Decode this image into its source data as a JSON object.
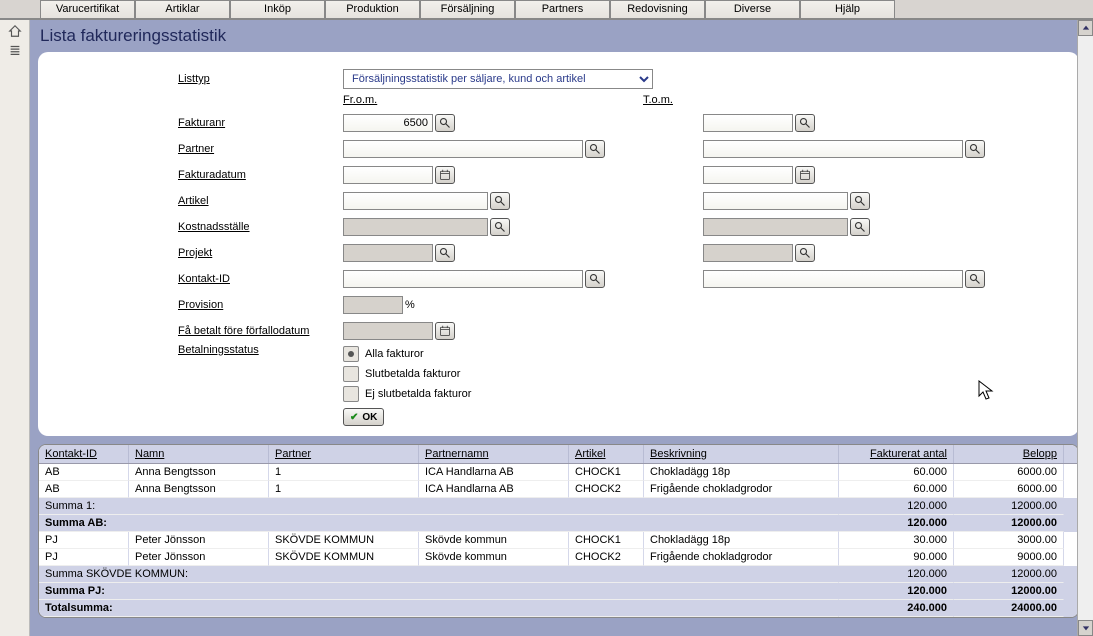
{
  "tabs": [
    "Varucertifikat",
    "Artiklar",
    "Inköp",
    "Produktion",
    "Försäljning",
    "Partners",
    "Redovisning",
    "Diverse",
    "Hjälp"
  ],
  "page_title": "Lista faktureringsstatistik",
  "labels": {
    "listtyp": "Listtyp",
    "from": "Fr.o.m.",
    "tom": "T.o.m.",
    "fakturanr": "Fakturanr",
    "partner": "Partner",
    "fakturadatum": "Fakturadatum",
    "artikel": "Artikel",
    "kostnadsstalle": "Kostnadsställe",
    "projekt": "Projekt",
    "kontaktid": "Kontakt-ID",
    "provision": "Provision",
    "pct": "%",
    "fa_betalt": "Få betalt före förfallodatum",
    "betalningsstatus": "Betalningsstatus"
  },
  "listtyp_value": "Försäljningsstatistik per säljare, kund och artikel",
  "fakturanr_value": "6500",
  "radios": {
    "alla": "Alla fakturor",
    "slut": "Slutbetalda fakturor",
    "ejslut": "Ej slutbetalda fakturor"
  },
  "ok_label": "OK",
  "grid": {
    "headers": [
      "Kontakt-ID",
      "Namn",
      "Partner",
      "Partnernamn",
      "Artikel",
      "Beskrivning",
      "Fakturerat antal",
      "Belopp"
    ],
    "rows": [
      {
        "type": "data",
        "cells": [
          "AB",
          "Anna Bengtsson",
          "1",
          "ICA Handlarna AB",
          "CHOCK1",
          "Chokladägg 18p",
          "60.000",
          "6000.00"
        ]
      },
      {
        "type": "data",
        "cells": [
          "AB",
          "Anna Bengtsson",
          "1",
          "ICA Handlarna AB",
          "CHOCK2",
          "Frigående chokladgrodor",
          "60.000",
          "6000.00"
        ]
      },
      {
        "type": "sum",
        "label": "Summa 1:",
        "antal": "120.000",
        "belopp": "12000.00",
        "bold": false
      },
      {
        "type": "sum",
        "label": "Summa AB:",
        "antal": "120.000",
        "belopp": "12000.00",
        "bold": true
      },
      {
        "type": "data",
        "cells": [
          "PJ",
          "Peter Jönsson",
          "SKÖVDE KOMMUN",
          "Skövde kommun",
          "CHOCK1",
          "Chokladägg 18p",
          "30.000",
          "3000.00"
        ]
      },
      {
        "type": "data",
        "cells": [
          "PJ",
          "Peter Jönsson",
          "SKÖVDE KOMMUN",
          "Skövde kommun",
          "CHOCK2",
          "Frigående chokladgrodor",
          "90.000",
          "9000.00"
        ]
      },
      {
        "type": "sum",
        "label": "Summa SKÖVDE KOMMUN:",
        "antal": "120.000",
        "belopp": "12000.00",
        "bold": false
      },
      {
        "type": "sum",
        "label": "Summa PJ:",
        "antal": "120.000",
        "belopp": "12000.00",
        "bold": true
      },
      {
        "type": "sum",
        "label": "Totalsumma:",
        "antal": "240.000",
        "belopp": "24000.00",
        "bold": true
      }
    ]
  }
}
